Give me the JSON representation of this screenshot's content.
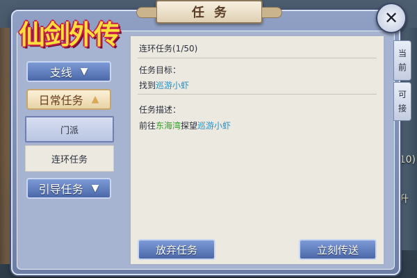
{
  "window": {
    "title": "任务"
  },
  "logo": {
    "text": "仙剑外传"
  },
  "sidebar": {
    "items": [
      {
        "label": "支线",
        "type": "category"
      },
      {
        "label": "日常任务",
        "type": "category",
        "expanded": true
      },
      {
        "label": "门派",
        "type": "subitem",
        "selected": true
      },
      {
        "label": "连环任务",
        "type": "subitem"
      },
      {
        "label": "引导任务",
        "type": "category"
      }
    ]
  },
  "quest": {
    "header": "连环任务(1/50)",
    "goal_label": "任务目标：",
    "goal_prefix": "找到",
    "goal_target": "巡游小虾",
    "desc_label": "任务描述：",
    "desc_prefix": "前往",
    "desc_place": "东海湾",
    "desc_mid": "探望",
    "desc_target": "巡游小虾"
  },
  "actions": {
    "abandon": "放弃任务",
    "teleport": "立刻传送"
  },
  "right_tabs": [
    {
      "chars": [
        "当",
        "前"
      ]
    },
    {
      "chars": [
        "可",
        "接"
      ]
    }
  ],
  "background_peek": {
    "right_a": "/10)",
    "right_b": "升"
  },
  "colors": {
    "highlight_blue": "#2a8fc4",
    "highlight_green": "#3a9a2e",
    "frame": "#8fa0c4"
  }
}
